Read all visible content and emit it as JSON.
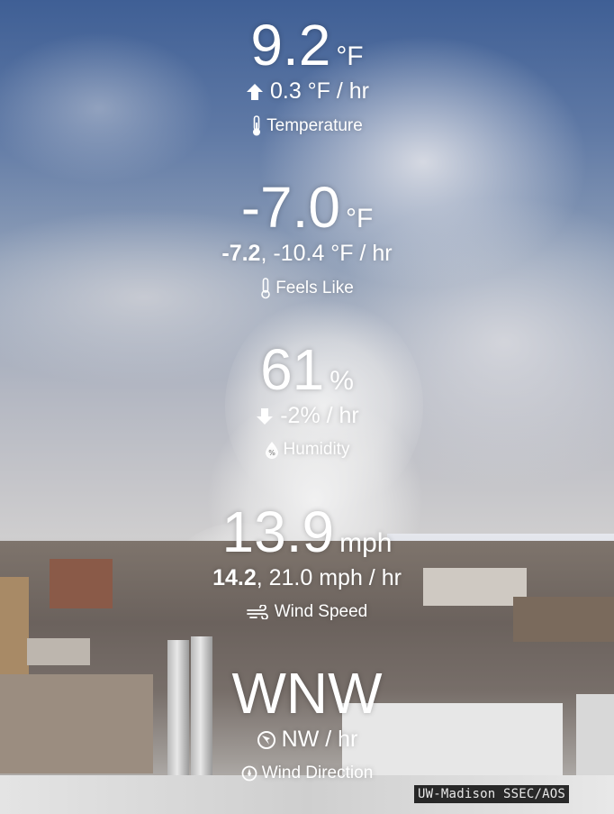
{
  "readings": {
    "temperature": {
      "value": "9.2",
      "unit": "°F",
      "trend_icon": "arrow-up-icon",
      "trend": "0.3 °F / hr",
      "label": "Temperature",
      "label_icon": "thermometer-icon"
    },
    "feels_like": {
      "value": "-7.0",
      "unit": "°F",
      "extra_bold": "-7.2",
      "extra_rest": ", -10.4 °F / hr",
      "label": "Feels Like",
      "label_icon": "thermometer-icon"
    },
    "humidity": {
      "value": "61",
      "unit": "%",
      "trend_icon": "arrow-down-icon",
      "trend": "-2% / hr",
      "label": "Humidity",
      "label_icon": "humidity-drop-icon"
    },
    "wind_speed": {
      "value": "13.9",
      "unit": "mph",
      "extra_bold": "14.2",
      "extra_rest": ", 21.0 mph / hr",
      "label": "Wind Speed",
      "label_icon": "wind-icon"
    },
    "wind_direction": {
      "value": "WNW",
      "trend_icon": "direction-icon",
      "trend": "NW / hr",
      "label": "Wind Direction",
      "label_icon": "compass-icon"
    }
  },
  "credit": "UW-Madison SSEC/AOS",
  "colors": {
    "text": "#ffffff",
    "credit_bg": "#000000"
  }
}
